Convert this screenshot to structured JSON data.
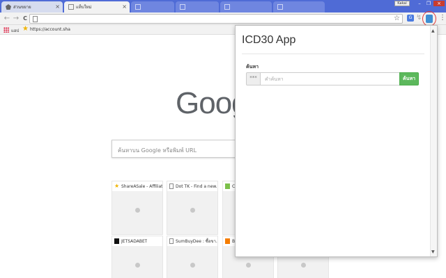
{
  "tabs": [
    {
      "label": "ส่วนขยาย",
      "state": "inactive"
    },
    {
      "label": "แท็บใหม่",
      "state": "active"
    },
    {
      "label": "",
      "state": "bg"
    },
    {
      "label": "",
      "state": "bg"
    },
    {
      "label": "",
      "state": "bg"
    },
    {
      "label": "",
      "state": "bg"
    }
  ],
  "window": {
    "user_badge": "Kakai"
  },
  "toolbar": {
    "back_icon": "←",
    "forward_icon": "→",
    "reload_icon": "C",
    "address_value": "",
    "star_icon": "☆",
    "translate_label": "G",
    "menu_icon": "⋮"
  },
  "bookmarks": {
    "apps_label": "แอป",
    "link_label": "https://account.sha"
  },
  "newtab": {
    "logo_text": "Goog",
    "search_placeholder": "ค้นหาบน Google หรือพิมพ์ URL",
    "tiles": [
      {
        "title": "ShareASale - Affiliat...",
        "favicon": "star"
      },
      {
        "title": "Dot TK - Find a new...",
        "favicon": "doc"
      },
      {
        "title": "C",
        "favicon": "green"
      },
      {
        "title": "JETSADABET",
        "favicon": "black"
      },
      {
        "title": "SumBuyDee : ซื้อขา...",
        "favicon": "doc"
      },
      {
        "title": "B",
        "favicon": "orange"
      }
    ]
  },
  "popup": {
    "title": "ICD30 App",
    "search_label": "ค้นหา",
    "addon_text": "***",
    "input_placeholder": "คำค้นหา",
    "input_value": "",
    "button_label": "ค้นหา",
    "scroll_up": "▲",
    "scroll_down": "▼"
  },
  "colors": {
    "tabstrip": "#4f6bd6",
    "button_green": "#5cb85c",
    "highlight_red": "#e23a3a"
  }
}
